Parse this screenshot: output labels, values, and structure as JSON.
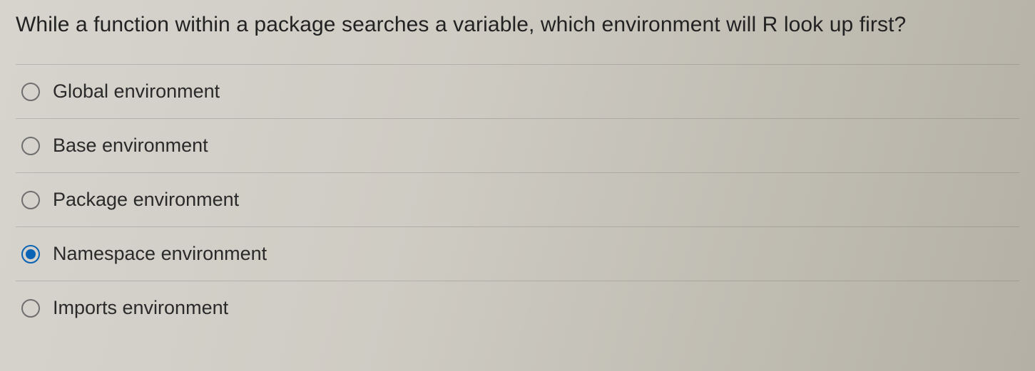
{
  "question": "While a function within a package searches a variable, which environment will R look up first?",
  "options": [
    {
      "label": "Global environment",
      "selected": false
    },
    {
      "label": "Base environment",
      "selected": false
    },
    {
      "label": "Package environment",
      "selected": false
    },
    {
      "label": "Namespace environment",
      "selected": true
    },
    {
      "label": "Imports environment",
      "selected": false
    }
  ]
}
